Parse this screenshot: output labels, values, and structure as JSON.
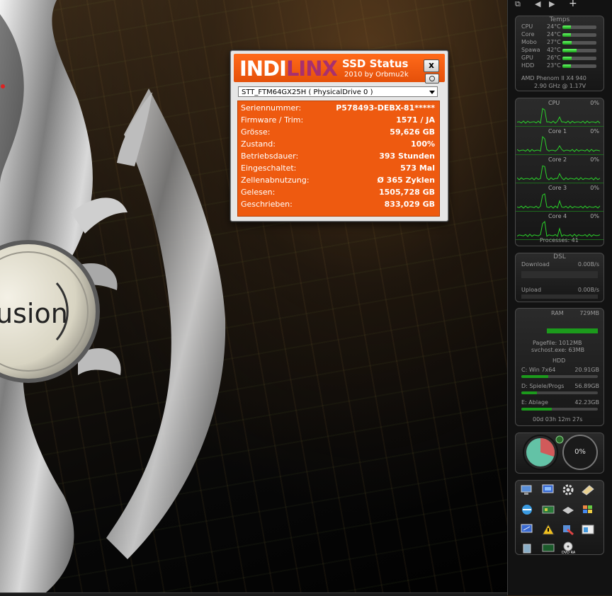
{
  "ssd": {
    "logo_part1": "INDI",
    "logo_part2": "LINX",
    "title": "SSD Status",
    "subtitle": "2010 by Orbmu2k",
    "close_label": "x",
    "drive": "STT_FTM64GX25H ( PhysicalDrive 0 )",
    "rows": [
      {
        "key": "Seriennummer:",
        "value": "P578493-DEBX-81*****"
      },
      {
        "key": "Firmware / Trim:",
        "value": "1571 / JA"
      },
      {
        "key": "Grösse:",
        "value": "59,626 GB"
      },
      {
        "key": "Zustand:",
        "value": "100%"
      },
      {
        "key": "Betriebsdauer:",
        "value": "393 Stunden"
      },
      {
        "key": "Eingeschaltet:",
        "value": "573 Mal"
      },
      {
        "key": "Zellenabnutzung:",
        "value": "Ø 365 Zyklen"
      },
      {
        "key": "Gelesen:",
        "value": "1505,728 GB"
      },
      {
        "key": "Geschrieben:",
        "value": "833,029 GB"
      }
    ],
    "accent": "#ee5a10"
  },
  "desktop": {
    "logo_text": "usion"
  },
  "sidebar": {
    "top": {
      "nav_prev": "◀",
      "nav_next": "▶",
      "add": "+"
    },
    "temps": {
      "title": "Temps",
      "rows": [
        {
          "name": "CPU",
          "value": "24°C",
          "level": 0.25
        },
        {
          "name": "Core",
          "value": "24°C",
          "level": 0.25
        },
        {
          "name": "Mobo",
          "value": "27°C",
          "level": 0.28
        },
        {
          "name": "Spawa",
          "value": "42°C",
          "level": 0.42
        },
        {
          "name": "GPU",
          "value": "26°C",
          "level": 0.27
        },
        {
          "name": "HDD",
          "value": "23°C",
          "level": 0.24
        }
      ],
      "cpu_model": "AMD Phenom II X4 940",
      "cpu_freq": "2.90 GHz @ 1.17V"
    },
    "cpu": {
      "graphs": [
        {
          "label": "CPU",
          "pct": "0%"
        },
        {
          "label": "Core 1",
          "pct": "0%"
        },
        {
          "label": "Core 2",
          "pct": "0%"
        },
        {
          "label": "Core 3",
          "pct": "0%"
        },
        {
          "label": "Core 4",
          "pct": "0%"
        }
      ],
      "processes": "Processes: 41"
    },
    "net": {
      "title": "DSL",
      "download_label": "Download",
      "download_value": "0.00B/s",
      "upload_label": "Upload",
      "upload_value": "0.00B/s"
    },
    "ram": {
      "title": "RAM",
      "value": "729MB",
      "pagefile": "Pagefile: 1012MB",
      "process": "svchost.exe: 63MB"
    },
    "hdd": {
      "title": "HDD",
      "drives": [
        {
          "name": "C: Win 7x64",
          "free": "20.91GB",
          "level": 0.35
        },
        {
          "name": "D: Spiele/Progs",
          "free": "56.89GB",
          "level": 0.2
        },
        {
          "name": "E: Ablage",
          "free": "42.23GB",
          "level": 0.4
        }
      ],
      "uptime": "00d 03h 12m 27s"
    },
    "meter": {
      "value": "0%",
      "pie_fraction": 0.3
    }
  }
}
